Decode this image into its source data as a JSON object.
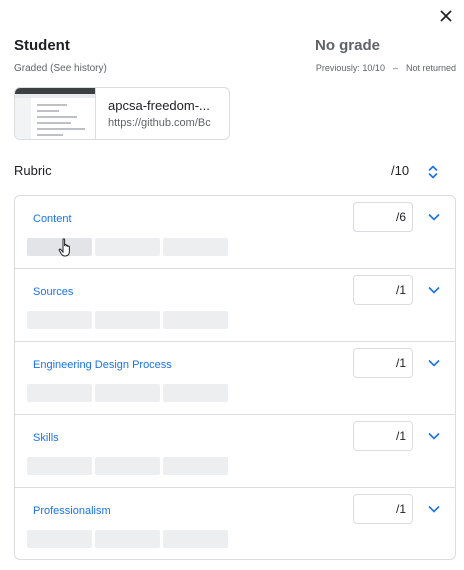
{
  "header": {
    "student_name": "Student",
    "graded_note": "Graded (See history)",
    "grade_status": "No grade",
    "previous": "Previously: 10/10",
    "separator": "–",
    "return_status": "Not returned"
  },
  "attachment": {
    "title": "apcsa-freedom-...",
    "url": "https://github.com/Bc"
  },
  "rubric": {
    "label": "Rubric",
    "total": "/10",
    "criteria": [
      {
        "name": "Content",
        "max": "/6"
      },
      {
        "name": "Sources",
        "max": "/1"
      },
      {
        "name": "Engineering Design Process",
        "max": "/1"
      },
      {
        "name": "Skills",
        "max": "/1"
      },
      {
        "name": "Professionalism",
        "max": "/1"
      }
    ]
  },
  "colors": {
    "accent": "#1a73e8",
    "text": "#202124",
    "muted": "#5f6368",
    "border": "#dadce0",
    "level_fill": "#eceef0"
  },
  "icons": {
    "close": "close-icon",
    "expand": "chevron-down-icon",
    "sort": "unfold-icon"
  }
}
